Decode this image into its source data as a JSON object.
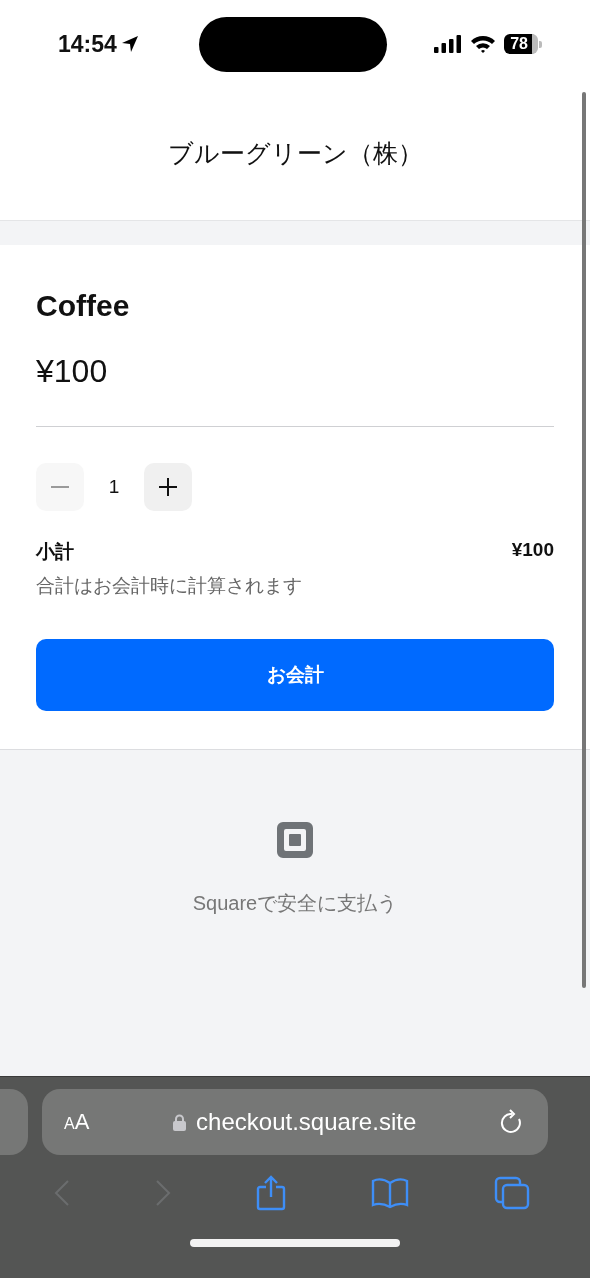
{
  "status_bar": {
    "time": "14:54",
    "battery": "78"
  },
  "header": {
    "title": "ブルーグリーン（株）"
  },
  "item": {
    "name": "Coffee",
    "price": "¥100"
  },
  "quantity": {
    "value": "1",
    "minus_disabled": true
  },
  "subtotal": {
    "label": "小計",
    "amount": "¥100",
    "note": "合計はお会計時に計算されます"
  },
  "checkout_button": "お会計",
  "footer": {
    "text": "Squareで安全に支払う"
  },
  "browser": {
    "text_size": "AA",
    "url": "checkout.square.site",
    "back_disabled": true,
    "forward_disabled": true
  }
}
